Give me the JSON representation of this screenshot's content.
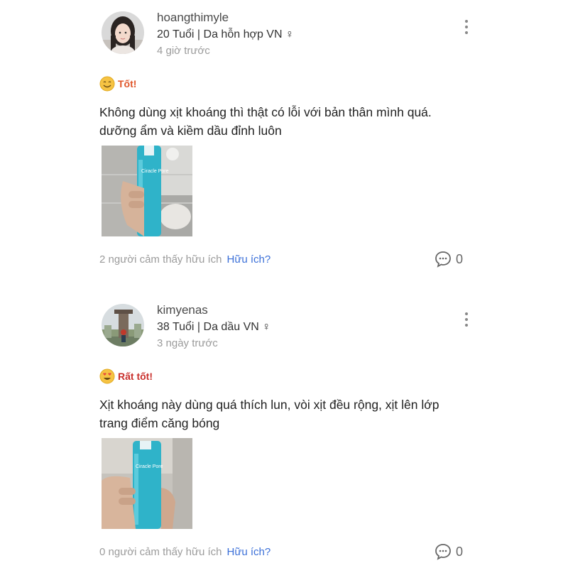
{
  "reviews": [
    {
      "username": "hoangthimyle",
      "info": "20 Tuổi | Da hỗn hợp VN ♀",
      "time": "4 giờ trước",
      "rating_label": "Tốt!",
      "rating_icon": "smile-emoji-icon",
      "text_lines": [
        "Không dùng xịt khoáng thì thật có lỗi với bản thân mình quá.",
        "dưỡng ẩm và kiềm dầu đỉnh luôn"
      ],
      "photo_brand_text": "Ciracle Pore",
      "helpful_count": "2 người cảm thấy hữu ích",
      "helpful_link": "Hữu ích?",
      "comment_count": "0"
    },
    {
      "username": "kimyenas",
      "info": "38 Tuổi | Da dầu VN ♀",
      "time": "3 ngày trước",
      "rating_label": "Rất tốt!",
      "rating_icon": "heart-eyes-emoji-icon",
      "text_lines": [
        "Xịt  khoáng này dùng quá thích lun, vòi xịt đều rộng, xịt lên lớp",
        "trang điểm căng bóng"
      ],
      "photo_brand_text": "Ciracle Pore",
      "helpful_count": "0 người cảm thấy hữu ích",
      "helpful_link": "Hữu ích?",
      "comment_count": "0"
    }
  ],
  "colors": {
    "link": "#3a6fd8",
    "rating_good": "#e0562a",
    "rating_great": "#c9302c",
    "muted": "#9b9b9b",
    "bottle": "#2fb3c9"
  }
}
